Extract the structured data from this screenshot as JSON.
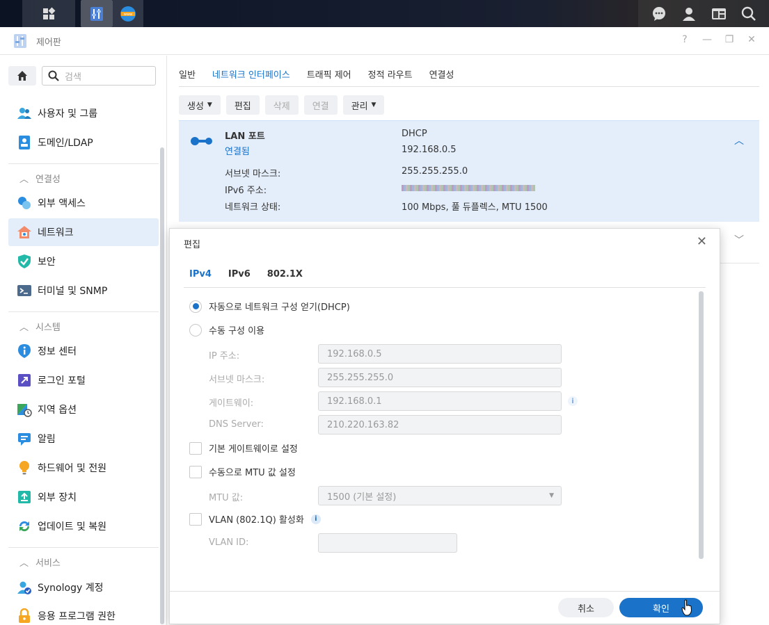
{
  "window": {
    "title": "제어판",
    "help": "?",
    "minimize": "—",
    "restore": "❐",
    "close": "✕"
  },
  "sidebar": {
    "search_placeholder": "검색",
    "items_top": [
      {
        "label": "사용자 및 그룹"
      },
      {
        "label": "도메인/LDAP"
      }
    ],
    "section_connectivity": "연결성",
    "items_connectivity": [
      {
        "label": "외부 액세스"
      },
      {
        "label": "네트워크"
      },
      {
        "label": "보안"
      },
      {
        "label": "터미널 및 SNMP"
      }
    ],
    "section_system": "시스템",
    "items_system": [
      {
        "label": "정보 센터"
      },
      {
        "label": "로그인 포털"
      },
      {
        "label": "지역 옵션"
      },
      {
        "label": "알림"
      },
      {
        "label": "하드웨어 및 전원"
      },
      {
        "label": "외부 장치"
      },
      {
        "label": "업데이트 및 복원"
      }
    ],
    "section_services": "서비스",
    "items_services": [
      {
        "label": "Synology 계정"
      },
      {
        "label": "응용 프로그램 권한"
      }
    ]
  },
  "main": {
    "tabs": [
      {
        "label": "일반"
      },
      {
        "label": "네트워크 인터페이스"
      },
      {
        "label": "트래픽 제어"
      },
      {
        "label": "정적 라우트"
      },
      {
        "label": "연결성"
      }
    ],
    "toolbar": {
      "create": "생성",
      "edit": "편집",
      "delete": "삭제",
      "connect": "연결",
      "manage": "관리"
    },
    "lan": {
      "name": "LAN 포트",
      "status": "연결됨",
      "mode": "DHCP",
      "ip": "192.168.0.5",
      "subnet_label": "서브넷 마스크:",
      "subnet": "255.255.255.0",
      "ipv6_label": "IPv6 주소:",
      "net_status_label": "네트워크 상태:",
      "net_status": "100 Mbps, 풀 듀플렉스, MTU 1500"
    }
  },
  "modal": {
    "title": "편집",
    "tabs": [
      {
        "label": "IPv4"
      },
      {
        "label": "IPv6"
      },
      {
        "label": "802.1X"
      }
    ],
    "radio_dhcp": "자동으로 네트워크 구성 얻기(DHCP)",
    "radio_manual": "수동 구성 이용",
    "ip_label": "IP 주소:",
    "ip_value": "192.168.0.5",
    "subnet_label": "서브넷 마스크:",
    "subnet_value": "255.255.255.0",
    "gateway_label": "게이트웨이:",
    "gateway_value": "192.168.0.1",
    "dns_label": "DNS Server:",
    "dns_value": "210.220.163.82",
    "default_gw": "기본 게이트웨이로 설정",
    "manual_mtu": "수동으로 MTU 값 설정",
    "mtu_label": "MTU 값:",
    "mtu_value": "1500 (기본 설정)",
    "vlan": "VLAN (802.1Q) 활성화",
    "vlan_id_label": "VLAN ID:",
    "cancel": "취소",
    "ok": "확인"
  },
  "colors": {
    "accent": "#1a73c9",
    "selected_bg": "#e4eefb"
  }
}
